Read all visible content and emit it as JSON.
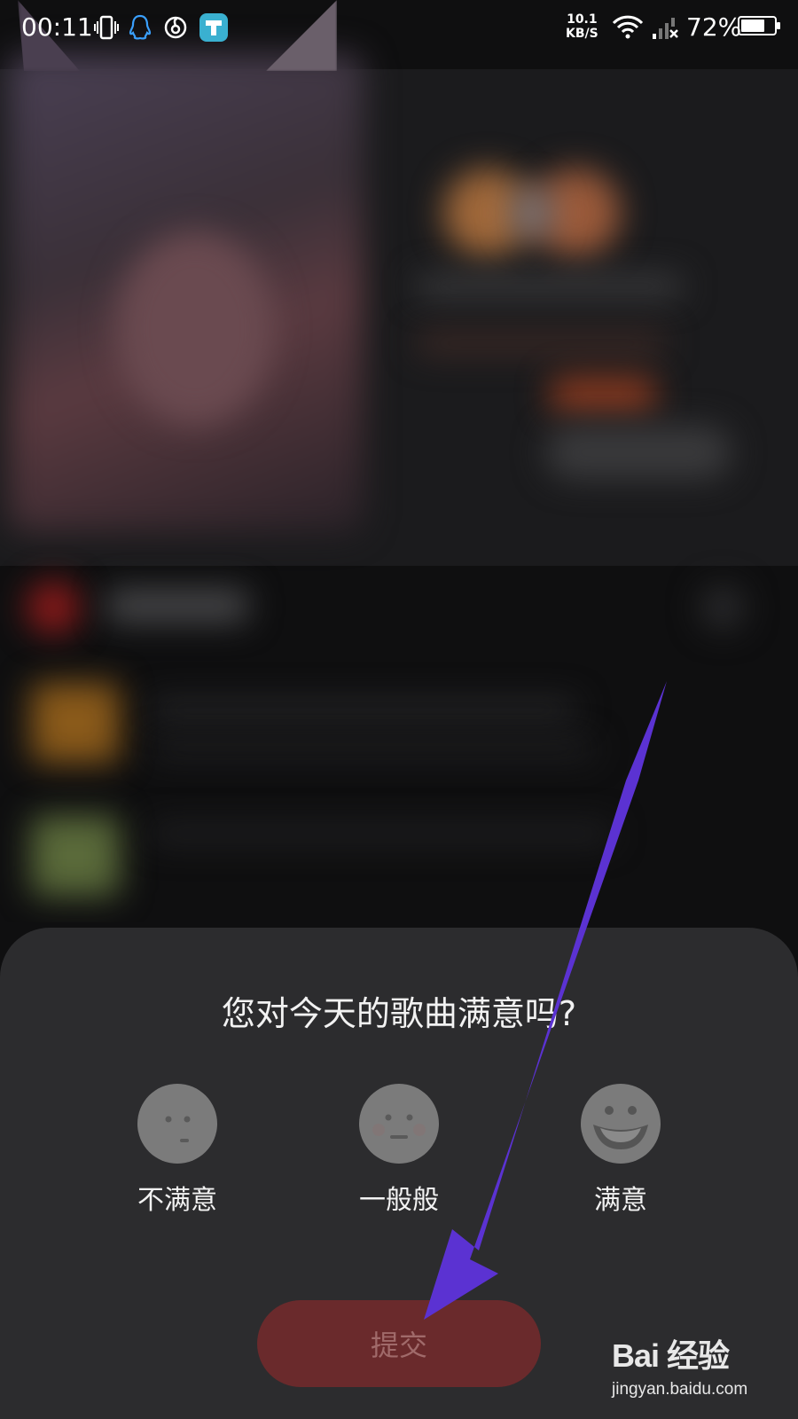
{
  "status_bar": {
    "time": "00:11",
    "net_speed_value": "10.1",
    "net_speed_unit": "KB/S",
    "battery_percent": "72%",
    "battery_level": 0.72,
    "icons": [
      "vibrate-icon",
      "qq-icon",
      "netease-music-icon",
      "app-icon",
      "wifi-icon",
      "signal-icon",
      "battery-icon"
    ]
  },
  "feedback": {
    "question": "您对今天的歌曲满意吗?",
    "options": [
      {
        "label": "不满意",
        "icon": "unsatisfied-face-icon"
      },
      {
        "label": "一般般",
        "icon": "neutral-face-icon"
      },
      {
        "label": "满意",
        "icon": "satisfied-face-icon"
      }
    ],
    "submit_label": "提交"
  },
  "watermark": {
    "logo": "Bai 经验",
    "url": "jingyan.baidu.com"
  },
  "colors": {
    "sheet_bg": "#2c2c2e",
    "submit_bg": "#6a2a2c",
    "arrow": "#5b32d2"
  }
}
